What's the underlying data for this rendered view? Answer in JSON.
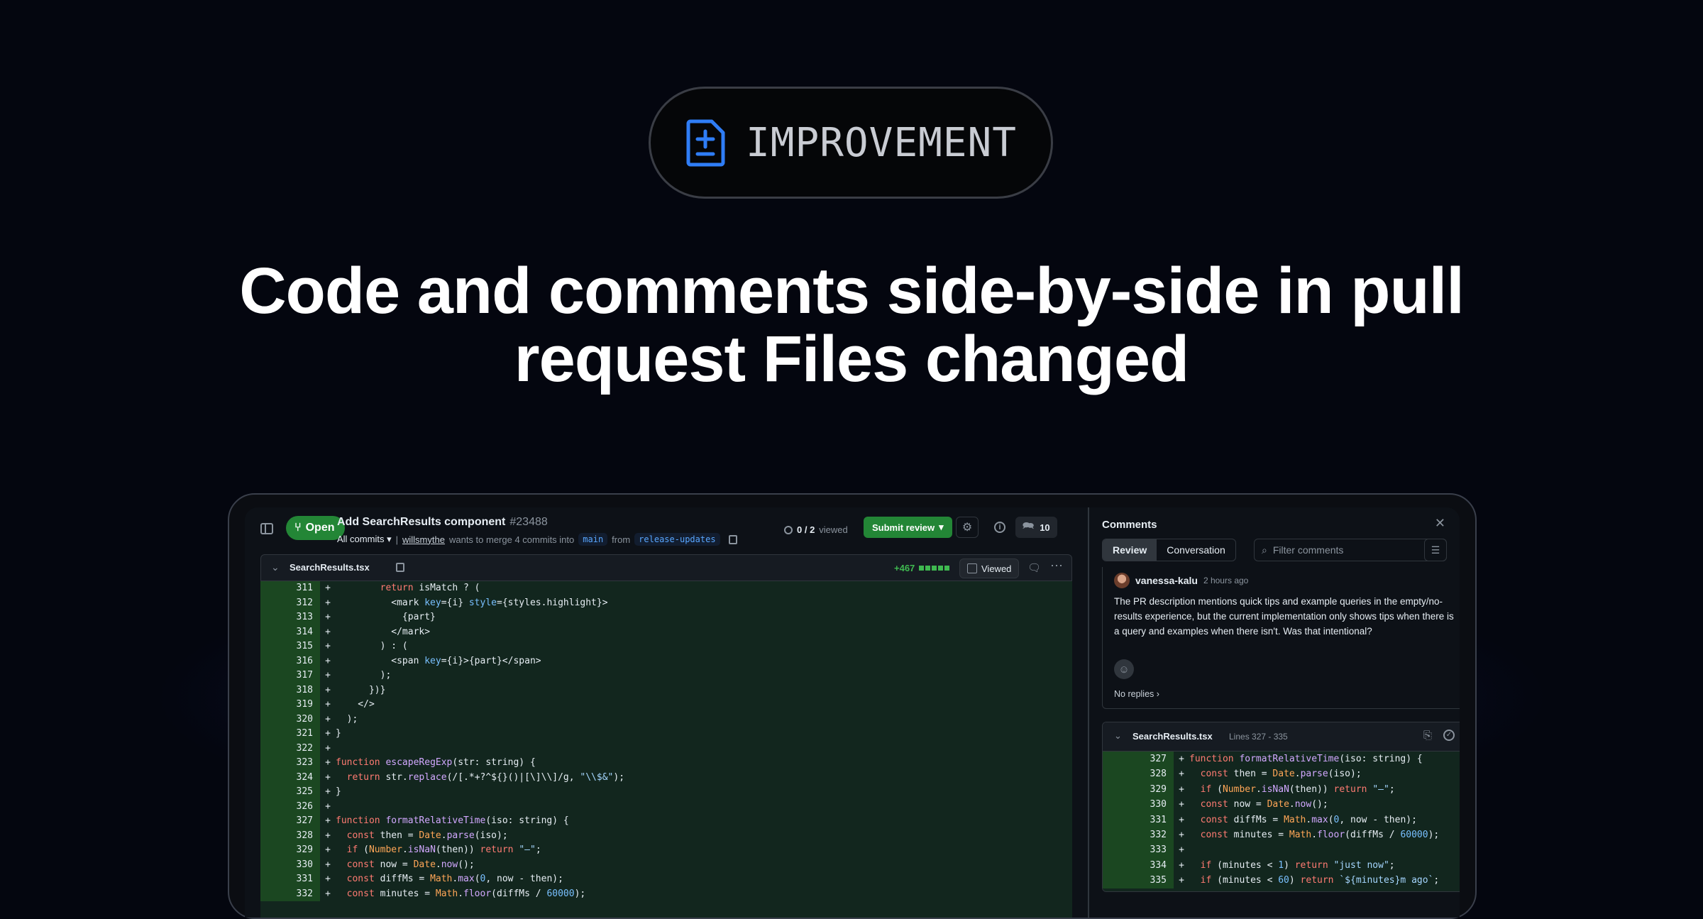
{
  "badge": {
    "label": "IMPROVEMENT",
    "icon": "file-diff-icon"
  },
  "headline": {
    "line1": "Code and comments side-by-side in pull",
    "line2": "request Files changed"
  },
  "pr": {
    "state": "Open",
    "title": "Add SearchResults component",
    "number": "#23488",
    "commits_filter": "All commits",
    "author": "willsmythe",
    "merge_text": "wants to merge 4 commits into",
    "base_branch": "main",
    "from_text": "from",
    "head_branch": "release-updates",
    "viewed_progress": "0 / 2",
    "viewed_word": "viewed",
    "submit_label": "Submit review",
    "comment_count": "10"
  },
  "file": {
    "name": "SearchResults.tsx",
    "additions": "+467",
    "viewed_label": "Viewed"
  },
  "diff_lines": [
    {
      "n": "311",
      "code": "        return isMatch ? ("
    },
    {
      "n": "312",
      "code": "          <mark key={i} style={styles.highlight}>"
    },
    {
      "n": "313",
      "code": "            {part}"
    },
    {
      "n": "314",
      "code": "          </mark>"
    },
    {
      "n": "315",
      "code": "        ) : ("
    },
    {
      "n": "316",
      "code": "          <span key={i}>{part}</span>"
    },
    {
      "n": "317",
      "code": "        );"
    },
    {
      "n": "318",
      "code": "      })}"
    },
    {
      "n": "319",
      "code": "    </>"
    },
    {
      "n": "320",
      "code": "  );"
    },
    {
      "n": "321",
      "code": "}"
    },
    {
      "n": "322",
      "code": ""
    },
    {
      "n": "323",
      "code": "function escapeRegExp(str: string) {"
    },
    {
      "n": "324",
      "code": "  return str.replace(/[.*+?^${}()|[\\]\\\\]/g, \"\\\\$&\");"
    },
    {
      "n": "325",
      "code": "}"
    },
    {
      "n": "326",
      "code": ""
    },
    {
      "n": "327",
      "code": "function formatRelativeTime(iso: string) {"
    },
    {
      "n": "328",
      "code": "  const then = Date.parse(iso);"
    },
    {
      "n": "329",
      "code": "  if (Number.isNaN(then)) return \"—\";"
    },
    {
      "n": "330",
      "code": "  const now = Date.now();"
    },
    {
      "n": "331",
      "code": "  const diffMs = Math.max(0, now - then);"
    },
    {
      "n": "332",
      "code": "  const minutes = Math.floor(diffMs / 60000);"
    }
  ],
  "comments_panel": {
    "title": "Comments",
    "tabs": [
      "Review",
      "Conversation"
    ],
    "filter_placeholder": "Filter comments",
    "comment": {
      "author": "vanessa-kalu",
      "time": "2 hours ago",
      "body": "The PR description mentions quick tips and example queries in the empty/no-results experience, but the current implementation only shows tips when there is a query and examples when there isn't. Was that intentional?",
      "replies": "No replies"
    },
    "snippet": {
      "file": "SearchResults.tsx",
      "lines": "Lines 327 - 335",
      "rows": [
        {
          "n": "327",
          "code": "function formatRelativeTime(iso: string) {"
        },
        {
          "n": "328",
          "code": "  const then = Date.parse(iso);"
        },
        {
          "n": "329",
          "code": "  if (Number.isNaN(then)) return \"—\";"
        },
        {
          "n": "330",
          "code": "  const now = Date.now();"
        },
        {
          "n": "331",
          "code": "  const diffMs = Math.max(0, now - then);"
        },
        {
          "n": "332",
          "code": "  const minutes = Math.floor(diffMs / 60000);"
        },
        {
          "n": "333",
          "code": ""
        },
        {
          "n": "334",
          "code": "  if (minutes < 1) return \"just now\";"
        },
        {
          "n": "335",
          "code": "  if (minutes < 60) return `${minutes}m ago`;"
        }
      ]
    }
  },
  "colors": {
    "accent": "#238636",
    "link": "#58a6ff",
    "background": "#04060f"
  }
}
